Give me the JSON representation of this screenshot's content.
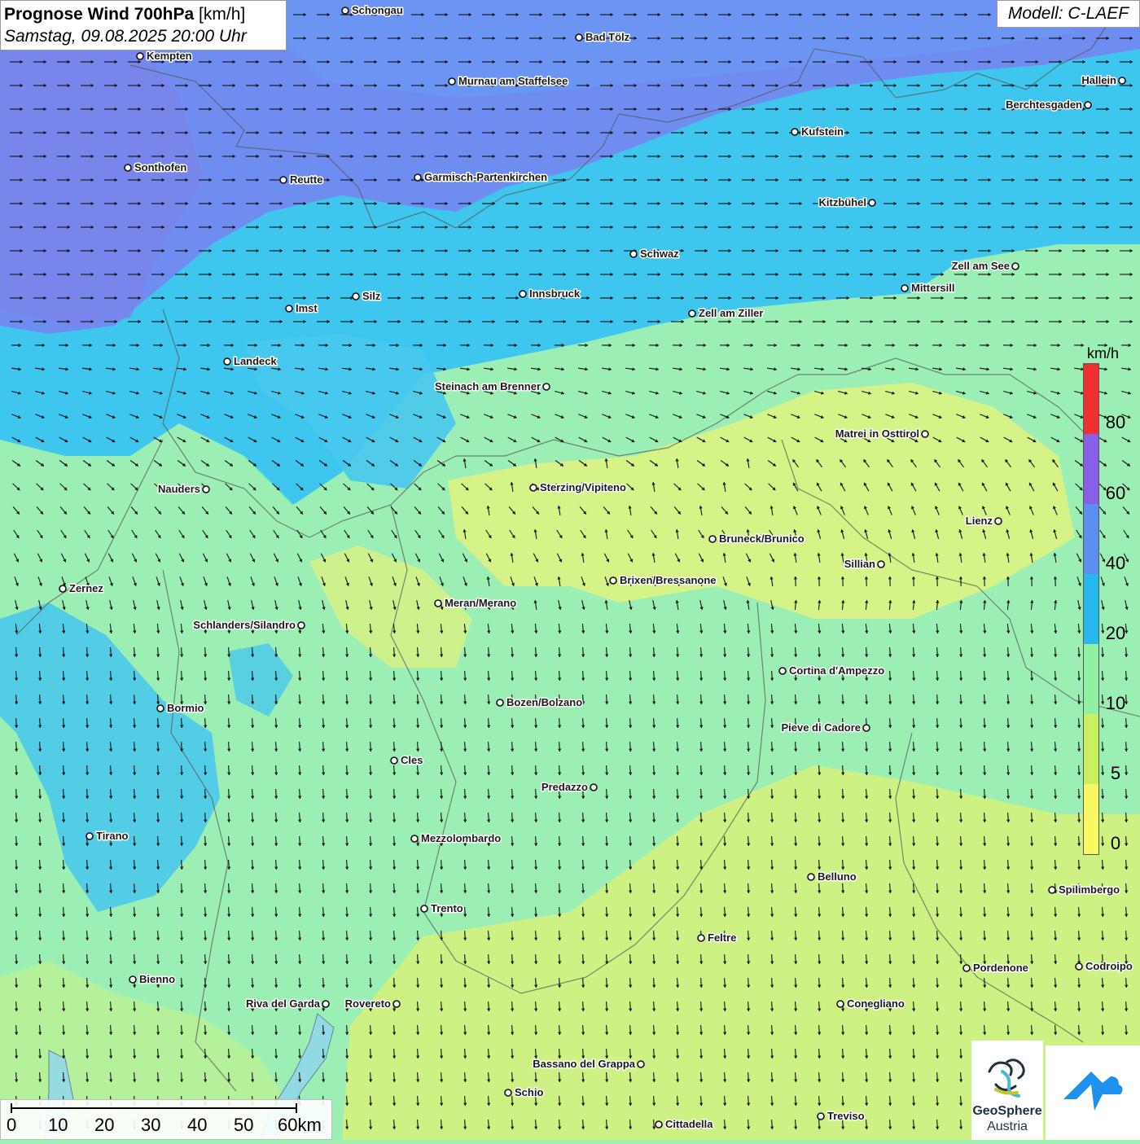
{
  "title": {
    "main": "Prognose Wind 700hPa",
    "unit": "[km/h]",
    "datetime": "Samstag, 09.08.2025 20:00 Uhr"
  },
  "model": "Modell: C-LAEF",
  "legend": {
    "unit": "km/h",
    "labels": [
      "80",
      "60",
      "40",
      "20",
      "10",
      "5",
      "0"
    ],
    "colors": [
      "#f03030",
      "#8860e8",
      "#5a8ef0",
      "#28b8f0",
      "#8ef0a0",
      "#c8f060",
      "#f8f860"
    ]
  },
  "scale_bar": {
    "labels": [
      "0",
      "10",
      "20",
      "30",
      "40",
      "50",
      "60km"
    ]
  },
  "logos": {
    "geosphere_line1": "GeoSphere",
    "geosphere_line2": "Austria"
  },
  "cities": [
    {
      "name": "Schongau",
      "label_side": "right"
    },
    {
      "name": "Bad Tölz",
      "label_side": "right"
    },
    {
      "name": "Kempten",
      "label_side": "right"
    },
    {
      "name": "Murnau am Staffelsee",
      "label_side": "right"
    },
    {
      "name": "Hallein",
      "label_side": "left"
    },
    {
      "name": "Berchtesgaden",
      "label_side": "left"
    },
    {
      "name": "Kufstein",
      "label_side": "right"
    },
    {
      "name": "Sonthofen",
      "label_side": "right"
    },
    {
      "name": "Reutte",
      "label_side": "right"
    },
    {
      "name": "Garmisch-Partenkirchen",
      "label_side": "right"
    },
    {
      "name": "Kitzbühel",
      "label_side": "left"
    },
    {
      "name": "Schwaz",
      "label_side": "right"
    },
    {
      "name": "Zell am See",
      "label_side": "left"
    },
    {
      "name": "Mittersill",
      "label_side": "right"
    },
    {
      "name": "Innsbruck",
      "label_side": "right"
    },
    {
      "name": "Silz",
      "label_side": "right"
    },
    {
      "name": "Imst",
      "label_side": "right"
    },
    {
      "name": "Zell am Ziller",
      "label_side": "right"
    },
    {
      "name": "Landeck",
      "label_side": "right"
    },
    {
      "name": "Steinach am Brenner",
      "label_side": "left"
    },
    {
      "name": "Matrei in Osttirol",
      "label_side": "left"
    },
    {
      "name": "Nauders",
      "label_side": "left"
    },
    {
      "name": "Sterzing/Vipiteno",
      "label_side": "right"
    },
    {
      "name": "Lienz",
      "label_side": "left"
    },
    {
      "name": "Bruneck/Brunico",
      "label_side": "right"
    },
    {
      "name": "Sillian",
      "label_side": "left"
    },
    {
      "name": "Brixen/Bressanone",
      "label_side": "right"
    },
    {
      "name": "Zernez",
      "label_side": "right"
    },
    {
      "name": "Meran/Merano",
      "label_side": "right"
    },
    {
      "name": "Schlanders/Silandro",
      "label_side": "left"
    },
    {
      "name": "Cortina d'Ampezzo",
      "label_side": "right"
    },
    {
      "name": "Bozen/Bolzano",
      "label_side": "right"
    },
    {
      "name": "Bormio",
      "label_side": "right"
    },
    {
      "name": "Pieve di Cadore",
      "label_side": "left"
    },
    {
      "name": "Cles",
      "label_side": "right"
    },
    {
      "name": "Predazzo",
      "label_side": "left"
    },
    {
      "name": "Tirano",
      "label_side": "right"
    },
    {
      "name": "Mezzolombardo",
      "label_side": "right"
    },
    {
      "name": "Belluno",
      "label_side": "right"
    },
    {
      "name": "Spilimbergo",
      "label_side": "right"
    },
    {
      "name": "Trento",
      "label_side": "right"
    },
    {
      "name": "Feltre",
      "label_side": "right"
    },
    {
      "name": "Pordenone",
      "label_side": "right"
    },
    {
      "name": "Codroipo",
      "label_side": "right"
    },
    {
      "name": "Bienno",
      "label_side": "right"
    },
    {
      "name": "Riva del Garda",
      "label_side": "left"
    },
    {
      "name": "Rovereto",
      "label_side": "left"
    },
    {
      "name": "Conegliano",
      "label_side": "right"
    },
    {
      "name": "Bassano del Grappa",
      "label_side": "left"
    },
    {
      "name": "Schio",
      "label_side": "right"
    },
    {
      "name": "Treviso",
      "label_side": "right"
    },
    {
      "name": "Cittadella",
      "label_side": "right"
    }
  ]
}
